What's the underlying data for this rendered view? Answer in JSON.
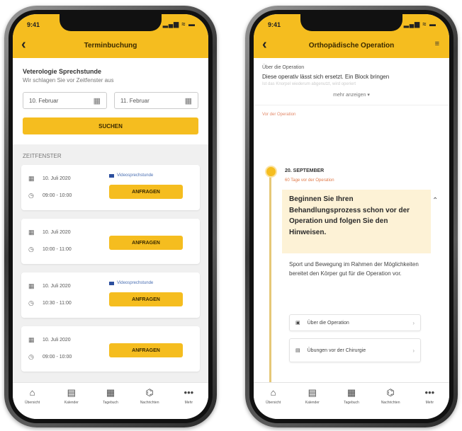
{
  "left": {
    "status": {
      "time": "9:41",
      "icons": "▂▄▆ ≈ ▬"
    },
    "title": "Terminbuchung",
    "search": {
      "title": "Veterologie Sprechstunde",
      "subtitle": "Wir schlagen Sie vor Zeitfenster aus",
      "date_from": "10. Februar",
      "date_to": "11. Februar",
      "button": "SUCHEN"
    },
    "section_label": "ZEITFENSTER",
    "slots": [
      {
        "date": "10. Juli 2020",
        "time": "09:00 - 10:00",
        "online": "Videosprechstunde",
        "button": "ANFRAGEN"
      },
      {
        "date": "10. Juli 2020",
        "time": "10:00 - 11:00",
        "button": "ANFRAGEN"
      },
      {
        "date": "10. Juli 2020",
        "time": "10:30 - 11:00",
        "online": "Videosprechstunde",
        "button": "ANFRAGEN"
      },
      {
        "date": "10. Juli 2020",
        "time": "09:00 - 10:00",
        "button": "ANFRAGEN"
      }
    ],
    "tabs": [
      {
        "icon": "⌂",
        "label": "Übersicht"
      },
      {
        "icon": "▤",
        "label": "Kalender"
      },
      {
        "icon": "▦",
        "label": "Tagebuch"
      },
      {
        "icon": "⌬",
        "label": "Nachrichten"
      },
      {
        "icon": "•••",
        "label": "Mehr"
      }
    ]
  },
  "right": {
    "status": {
      "time": "9:41",
      "icons": "▂▄▆ ≈ ▬"
    },
    "title": "Orthopädische Operation",
    "filter_icon": "≡",
    "about_head": "Über die Operation",
    "about_text": "Diese operativ lässt sich ersetzt. Ein Block bringen",
    "about_fade": "Ist das Knorpel wiederum abgenutzt, wird operiert",
    "more": "mehr anzeigen ▾",
    "pre_label": "Vor der Operation",
    "step": {
      "date": "20. SEPTEMBER",
      "sub": "60 Tage vor der Operation",
      "callout": "Beginnen Sie Ihren Behandlungsprozess schon vor der Operation und folgen Sie den Hinweisen.",
      "body": "Sport und Bewegung im Rahmen der Möglichkeiten bereitet den Körper gut für die Operation vor."
    },
    "links": [
      {
        "icon": "▣",
        "label": "Über die Operation"
      },
      {
        "icon": "▤",
        "label": "Übungen vor der Chirurgie"
      }
    ],
    "tabs": [
      {
        "icon": "⌂",
        "label": "Übersicht"
      },
      {
        "icon": "▤",
        "label": "Kalender"
      },
      {
        "icon": "▦",
        "label": "Tagebuch"
      },
      {
        "icon": "⌬",
        "label": "Nachrichten"
      },
      {
        "icon": "•••",
        "label": "Mehr"
      }
    ]
  }
}
